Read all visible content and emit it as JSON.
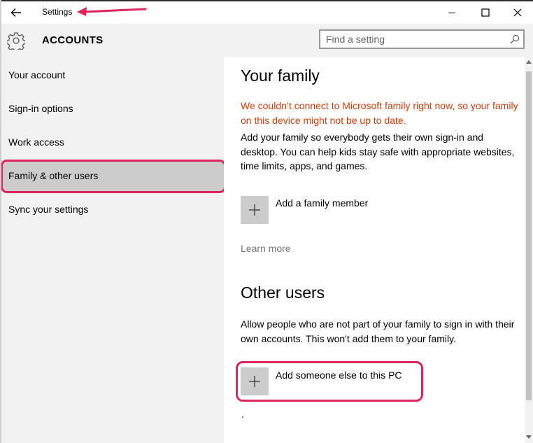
{
  "window": {
    "title": "Settings"
  },
  "header": {
    "section_title": "ACCOUNTS",
    "search_placeholder": "Find a setting"
  },
  "sidebar": {
    "items": [
      {
        "label": "Your account"
      },
      {
        "label": "Sign-in options"
      },
      {
        "label": "Work access"
      },
      {
        "label": "Family & other users",
        "selected": true
      },
      {
        "label": "Sync your settings"
      }
    ]
  },
  "content": {
    "family": {
      "title": "Your family",
      "warning": "We couldn’t connect to Microsoft family right now, so your family on this device might not be up to date.",
      "description": "Add your family so everybody gets their own sign-in and desktop. You can help kids stay safe with appropriate websites, time limits, apps, and games.",
      "add_label": "Add a family member",
      "learn_more": "Learn more"
    },
    "other_users": {
      "title": "Other users",
      "description": "Allow people who are not part of your family to sign in with their own accounts. This won't add them to your family.",
      "add_label": "Add someone else to this PC"
    }
  },
  "colors": {
    "warning": "#d83b01",
    "annotation": "#e0245e",
    "sidebar_bg": "#f2f2f2",
    "selected_bg": "#cccccc"
  },
  "icons": [
    "back-arrow-icon",
    "minimize-icon",
    "maximize-icon",
    "close-icon",
    "gear-icon",
    "search-icon",
    "plus-icon"
  ]
}
